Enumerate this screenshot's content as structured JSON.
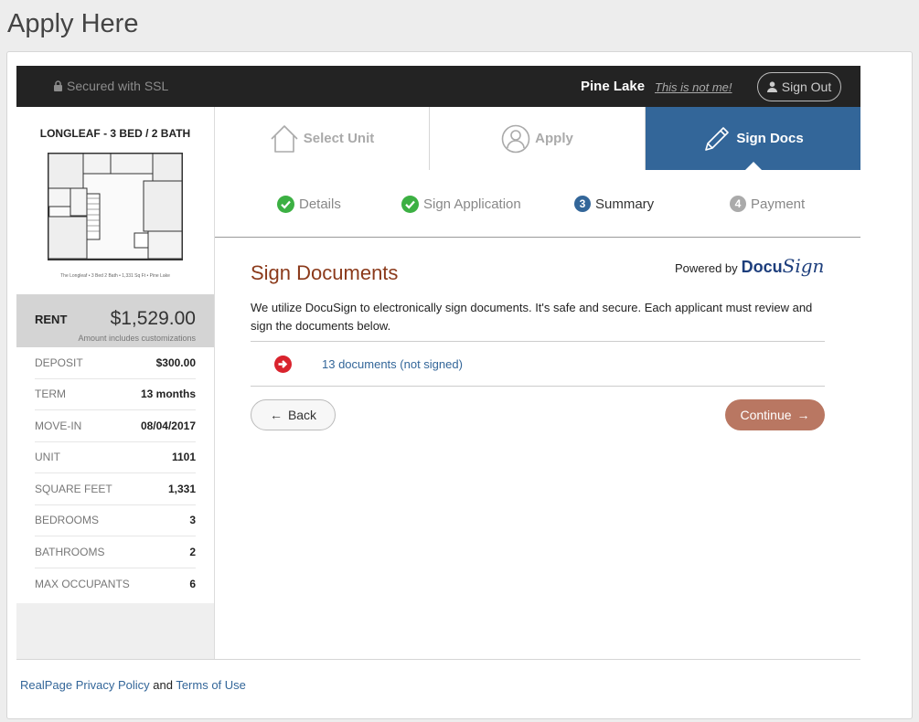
{
  "page": {
    "title": "Apply Here"
  },
  "topbar": {
    "ssl_label": "Secured with SSL",
    "community": "Pine Lake",
    "not_me_link": "This is not me!",
    "sign_out_label": "Sign Out"
  },
  "unit": {
    "name": "LONGLEAF - 3 BED / 2 BATH",
    "floorplan_caption": "The Longleaf • 3 Bed 2 Bath • 1,331 Sq Ft • Pine Lake",
    "rent_label": "RENT",
    "rent_value": "$1,529.00",
    "rent_note": "Amount includes customizations",
    "details": [
      {
        "label": "DEPOSIT",
        "value": "$300.00"
      },
      {
        "label": "TERM",
        "value": "13 months"
      },
      {
        "label": "MOVE-IN",
        "value": "08/04/2017"
      },
      {
        "label": "UNIT",
        "value": "1101"
      },
      {
        "label": "SQUARE FEET",
        "value": "1,331"
      },
      {
        "label": "BEDROOMS",
        "value": "3"
      },
      {
        "label": "BATHROOMS",
        "value": "2"
      },
      {
        "label": "MAX OCCUPANTS",
        "value": "6"
      }
    ]
  },
  "tabs": [
    {
      "label": "Select Unit",
      "icon": "house-icon",
      "active": false
    },
    {
      "label": "Apply",
      "icon": "user-icon",
      "active": false
    },
    {
      "label": "Sign Docs",
      "icon": "pencil-icon",
      "active": true
    }
  ],
  "substeps": [
    {
      "label": "Details",
      "status": "complete"
    },
    {
      "label": "Sign Application",
      "status": "complete"
    },
    {
      "num": "3",
      "label": "Summary",
      "status": "current"
    },
    {
      "num": "4",
      "label": "Payment",
      "status": "pending"
    }
  ],
  "content": {
    "title": "Sign Documents",
    "powered_by": "Powered by",
    "docusign_docu": "Docu",
    "docusign_sign": "Sign",
    "description": "We utilize DocuSign to electronically sign documents. It's safe and secure. Each applicant must review and sign the documents below.",
    "doc_link": "13 documents (not signed)",
    "back_label": "Back",
    "continue_label": "Continue"
  },
  "footer": {
    "privacy_link": "RealPage Privacy Policy",
    "and": " and ",
    "terms_link": "Terms of Use"
  },
  "colors": {
    "accent_blue": "#336699",
    "title_brown": "#8b3a1b",
    "continue_bg": "#b97762",
    "complete_green": "#3cb043",
    "error_red": "#d9232d"
  }
}
